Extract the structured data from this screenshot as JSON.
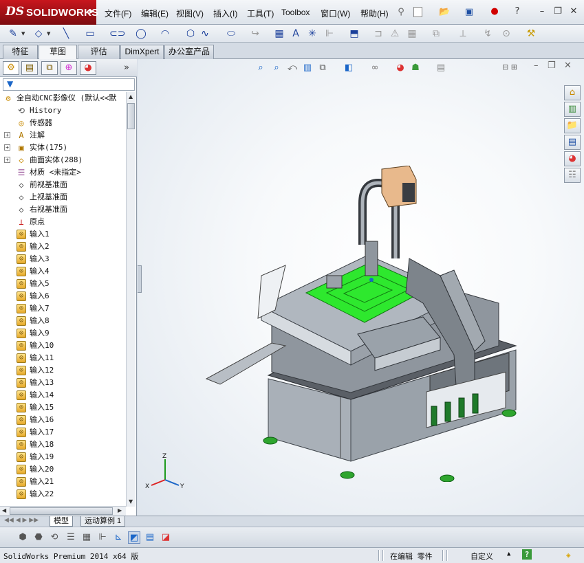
{
  "app": {
    "logo_ds": "DS",
    "logo_name": "SOLIDWORKS"
  },
  "menu": [
    "文件(F)",
    "编辑(E)",
    "视图(V)",
    "插入(I)",
    "工具(T)",
    "Toolbox",
    "窗口(W)",
    "帮助(H)"
  ],
  "tabs": [
    "特征",
    "草图",
    "评估",
    "DimXpert",
    "办公室产品"
  ],
  "active_tab": "草图",
  "filter_icon": "funnel-icon",
  "tree": {
    "root": "全自动CNC影像仪  (默认<<默",
    "items": [
      {
        "label": "History",
        "icon": "history-icon",
        "expandable": false
      },
      {
        "label": "传感器",
        "icon": "sensor-icon",
        "expandable": false
      },
      {
        "label": "注解",
        "icon": "annotation-icon",
        "expandable": true
      },
      {
        "label": "实体(175)",
        "icon": "solid-bodies-icon",
        "expandable": true
      },
      {
        "label": "曲面实体(288)",
        "icon": "surface-bodies-icon",
        "expandable": true
      },
      {
        "label": "材质 <未指定>",
        "icon": "material-icon",
        "expandable": false
      },
      {
        "label": "前视基准面",
        "icon": "plane-icon",
        "expandable": false
      },
      {
        "label": "上视基准面",
        "icon": "plane-icon",
        "expandable": false
      },
      {
        "label": "右视基准面",
        "icon": "plane-icon",
        "expandable": false
      },
      {
        "label": "原点",
        "icon": "origin-icon",
        "expandable": false
      },
      {
        "label": "输入1",
        "icon": "imported-icon",
        "expandable": false
      },
      {
        "label": "输入2",
        "icon": "imported-icon",
        "expandable": false
      },
      {
        "label": "输入3",
        "icon": "imported-icon",
        "expandable": false
      },
      {
        "label": "输入4",
        "icon": "imported-icon",
        "expandable": false
      },
      {
        "label": "输入5",
        "icon": "imported-icon",
        "expandable": false
      },
      {
        "label": "输入6",
        "icon": "imported-icon",
        "expandable": false
      },
      {
        "label": "输入7",
        "icon": "imported-icon",
        "expandable": false
      },
      {
        "label": "输入8",
        "icon": "imported-icon",
        "expandable": false
      },
      {
        "label": "输入9",
        "icon": "imported-icon",
        "expandable": false
      },
      {
        "label": "输入10",
        "icon": "imported-icon",
        "expandable": false
      },
      {
        "label": "输入11",
        "icon": "imported-icon",
        "expandable": false
      },
      {
        "label": "输入12",
        "icon": "imported-icon",
        "expandable": false
      },
      {
        "label": "输入13",
        "icon": "imported-icon",
        "expandable": false
      },
      {
        "label": "输入14",
        "icon": "imported-icon",
        "expandable": false
      },
      {
        "label": "输入15",
        "icon": "imported-icon",
        "expandable": false
      },
      {
        "label": "输入16",
        "icon": "imported-icon",
        "expandable": false
      },
      {
        "label": "输入17",
        "icon": "imported-icon",
        "expandable": false
      },
      {
        "label": "输入18",
        "icon": "imported-icon",
        "expandable": false
      },
      {
        "label": "输入19",
        "icon": "imported-icon",
        "expandable": false
      },
      {
        "label": "输入20",
        "icon": "imported-icon",
        "expandable": false
      },
      {
        "label": "输入21",
        "icon": "imported-icon",
        "expandable": false
      },
      {
        "label": "输入22",
        "icon": "imported-icon",
        "expandable": false
      }
    ]
  },
  "triad": {
    "x": "X",
    "y": "Y",
    "z": "Z"
  },
  "bottom_tabs": [
    "模型",
    "运动算例 1"
  ],
  "status": {
    "product": "SolidWorks Premium 2014 x64 版",
    "mode": "在编辑 零件",
    "units": "自定义",
    "help": "?"
  },
  "colors": {
    "brand": "#c8161d",
    "accent_green": "#2ee82e",
    "machine_body": "#a9b0b8",
    "machine_dark": "#5a5f66",
    "gantry_tan": "#e8b98c"
  }
}
